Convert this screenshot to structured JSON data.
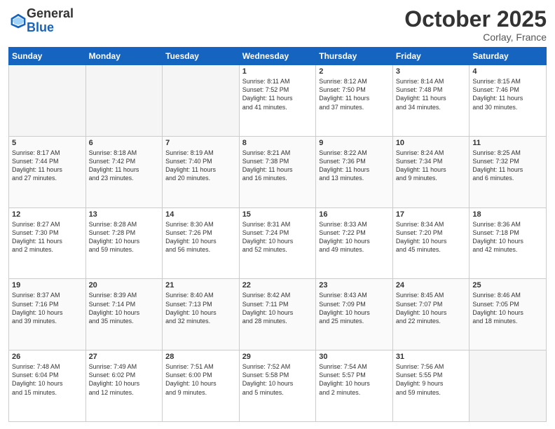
{
  "logo": {
    "general": "General",
    "blue": "Blue"
  },
  "header": {
    "month": "October 2025",
    "location": "Corlay, France"
  },
  "weekdays": [
    "Sunday",
    "Monday",
    "Tuesday",
    "Wednesday",
    "Thursday",
    "Friday",
    "Saturday"
  ],
  "weeks": [
    [
      {
        "day": "",
        "info": ""
      },
      {
        "day": "",
        "info": ""
      },
      {
        "day": "",
        "info": ""
      },
      {
        "day": "1",
        "info": "Sunrise: 8:11 AM\nSunset: 7:52 PM\nDaylight: 11 hours\nand 41 minutes."
      },
      {
        "day": "2",
        "info": "Sunrise: 8:12 AM\nSunset: 7:50 PM\nDaylight: 11 hours\nand 37 minutes."
      },
      {
        "day": "3",
        "info": "Sunrise: 8:14 AM\nSunset: 7:48 PM\nDaylight: 11 hours\nand 34 minutes."
      },
      {
        "day": "4",
        "info": "Sunrise: 8:15 AM\nSunset: 7:46 PM\nDaylight: 11 hours\nand 30 minutes."
      }
    ],
    [
      {
        "day": "5",
        "info": "Sunrise: 8:17 AM\nSunset: 7:44 PM\nDaylight: 11 hours\nand 27 minutes."
      },
      {
        "day": "6",
        "info": "Sunrise: 8:18 AM\nSunset: 7:42 PM\nDaylight: 11 hours\nand 23 minutes."
      },
      {
        "day": "7",
        "info": "Sunrise: 8:19 AM\nSunset: 7:40 PM\nDaylight: 11 hours\nand 20 minutes."
      },
      {
        "day": "8",
        "info": "Sunrise: 8:21 AM\nSunset: 7:38 PM\nDaylight: 11 hours\nand 16 minutes."
      },
      {
        "day": "9",
        "info": "Sunrise: 8:22 AM\nSunset: 7:36 PM\nDaylight: 11 hours\nand 13 minutes."
      },
      {
        "day": "10",
        "info": "Sunrise: 8:24 AM\nSunset: 7:34 PM\nDaylight: 11 hours\nand 9 minutes."
      },
      {
        "day": "11",
        "info": "Sunrise: 8:25 AM\nSunset: 7:32 PM\nDaylight: 11 hours\nand 6 minutes."
      }
    ],
    [
      {
        "day": "12",
        "info": "Sunrise: 8:27 AM\nSunset: 7:30 PM\nDaylight: 11 hours\nand 2 minutes."
      },
      {
        "day": "13",
        "info": "Sunrise: 8:28 AM\nSunset: 7:28 PM\nDaylight: 10 hours\nand 59 minutes."
      },
      {
        "day": "14",
        "info": "Sunrise: 8:30 AM\nSunset: 7:26 PM\nDaylight: 10 hours\nand 56 minutes."
      },
      {
        "day": "15",
        "info": "Sunrise: 8:31 AM\nSunset: 7:24 PM\nDaylight: 10 hours\nand 52 minutes."
      },
      {
        "day": "16",
        "info": "Sunrise: 8:33 AM\nSunset: 7:22 PM\nDaylight: 10 hours\nand 49 minutes."
      },
      {
        "day": "17",
        "info": "Sunrise: 8:34 AM\nSunset: 7:20 PM\nDaylight: 10 hours\nand 45 minutes."
      },
      {
        "day": "18",
        "info": "Sunrise: 8:36 AM\nSunset: 7:18 PM\nDaylight: 10 hours\nand 42 minutes."
      }
    ],
    [
      {
        "day": "19",
        "info": "Sunrise: 8:37 AM\nSunset: 7:16 PM\nDaylight: 10 hours\nand 39 minutes."
      },
      {
        "day": "20",
        "info": "Sunrise: 8:39 AM\nSunset: 7:14 PM\nDaylight: 10 hours\nand 35 minutes."
      },
      {
        "day": "21",
        "info": "Sunrise: 8:40 AM\nSunset: 7:13 PM\nDaylight: 10 hours\nand 32 minutes."
      },
      {
        "day": "22",
        "info": "Sunrise: 8:42 AM\nSunset: 7:11 PM\nDaylight: 10 hours\nand 28 minutes."
      },
      {
        "day": "23",
        "info": "Sunrise: 8:43 AM\nSunset: 7:09 PM\nDaylight: 10 hours\nand 25 minutes."
      },
      {
        "day": "24",
        "info": "Sunrise: 8:45 AM\nSunset: 7:07 PM\nDaylight: 10 hours\nand 22 minutes."
      },
      {
        "day": "25",
        "info": "Sunrise: 8:46 AM\nSunset: 7:05 PM\nDaylight: 10 hours\nand 18 minutes."
      }
    ],
    [
      {
        "day": "26",
        "info": "Sunrise: 7:48 AM\nSunset: 6:04 PM\nDaylight: 10 hours\nand 15 minutes."
      },
      {
        "day": "27",
        "info": "Sunrise: 7:49 AM\nSunset: 6:02 PM\nDaylight: 10 hours\nand 12 minutes."
      },
      {
        "day": "28",
        "info": "Sunrise: 7:51 AM\nSunset: 6:00 PM\nDaylight: 10 hours\nand 9 minutes."
      },
      {
        "day": "29",
        "info": "Sunrise: 7:52 AM\nSunset: 5:58 PM\nDaylight: 10 hours\nand 5 minutes."
      },
      {
        "day": "30",
        "info": "Sunrise: 7:54 AM\nSunset: 5:57 PM\nDaylight: 10 hours\nand 2 minutes."
      },
      {
        "day": "31",
        "info": "Sunrise: 7:56 AM\nSunset: 5:55 PM\nDaylight: 9 hours\nand 59 minutes."
      },
      {
        "day": "",
        "info": ""
      }
    ]
  ]
}
